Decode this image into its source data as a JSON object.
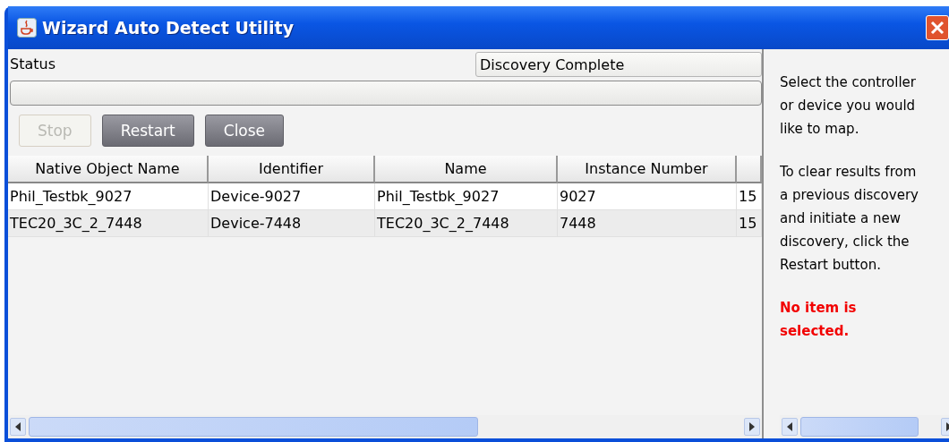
{
  "window": {
    "title": "Wizard Auto Detect Utility"
  },
  "status": {
    "label": "Status",
    "value": "Discovery Complete"
  },
  "progress": {
    "level": 0
  },
  "buttons": [
    {
      "label": "Stop",
      "disabled": true
    },
    {
      "label": "Restart",
      "disabled": false
    },
    {
      "label": "Close",
      "disabled": false
    }
  ],
  "table": {
    "columns": [
      "Native Object Name",
      "Identifier",
      "Name",
      "Instance Number"
    ],
    "rows": [
      [
        "Phil_Testbk_9027",
        "Device-9027",
        "Phil_Testbk_9027",
        "9027",
        "15"
      ],
      [
        "TEC20_3C_2_7448",
        "Device-7448",
        "TEC20_3C_2_7448",
        "7448",
        "15"
      ]
    ]
  },
  "help": {
    "paragraphs": [
      "Select the controller or device you would like to map.",
      "To clear results from a previous discovery and initiate a new discovery, click the Restart button."
    ],
    "warning": "No item is selected."
  }
}
